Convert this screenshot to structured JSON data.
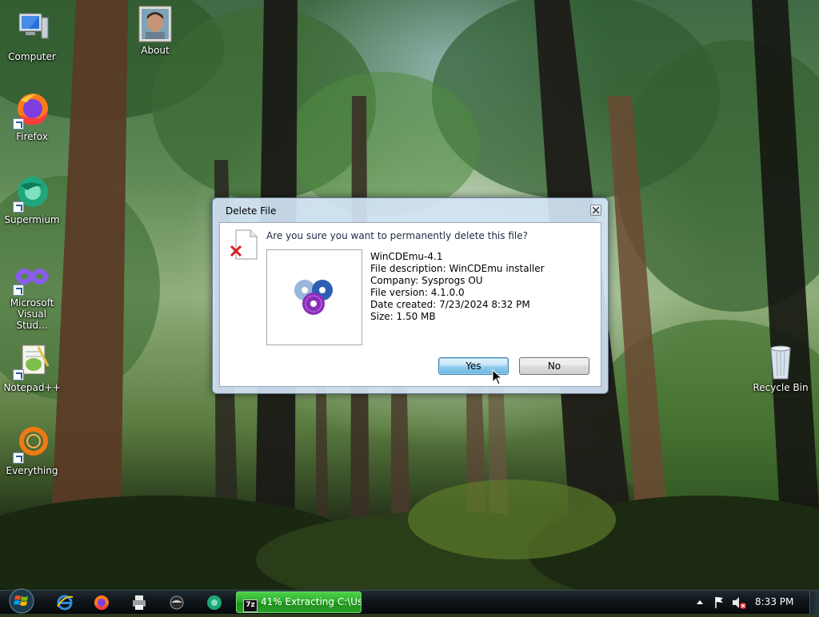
{
  "desktop": {
    "icons": [
      {
        "label": "Computer",
        "icon": "computer-icon"
      },
      {
        "label": "About",
        "icon": "user-photo-icon"
      },
      {
        "label": "Firefox",
        "icon": "firefox-icon"
      },
      {
        "label": "Supermium",
        "icon": "supermium-icon"
      },
      {
        "label": "Microsoft Visual Stud...",
        "icon": "visual-studio-icon"
      },
      {
        "label": "Notepad++",
        "icon": "notepadpp-icon"
      },
      {
        "label": "Everything",
        "icon": "everything-icon"
      },
      {
        "label": "Recycle Bin",
        "icon": "recycle-bin-icon"
      }
    ]
  },
  "dialog": {
    "title": "Delete File",
    "question": "Are you sure you want to permanently delete this file?",
    "file": {
      "name": "WinCDEmu-4.1",
      "description": "File description: WinCDEmu installer",
      "company": "Company: Sysprogs OU",
      "version": "File version: 4.1.0.0",
      "created": "Date created: 7/23/2024 8:32 PM",
      "size": "Size: 1.50 MB"
    },
    "buttons": {
      "yes": "Yes",
      "no": "No"
    }
  },
  "taskbar": {
    "pinned": [
      "internet-explorer-icon",
      "firefox-icon",
      "printer-icon",
      "media-icon",
      "supermium-icon"
    ],
    "active_task": {
      "tag": "7z",
      "label": "41% Extracting C:\\Us..."
    },
    "tray_icons": [
      "show-hidden-icons-icon",
      "action-center-flag-icon",
      "volume-muted-icon"
    ],
    "clock": "8:33 PM"
  },
  "colors": {
    "task_progress_green": "#2fae2d",
    "dialog_frame": "#d2e4f5",
    "default_button": "#98d1ef"
  }
}
